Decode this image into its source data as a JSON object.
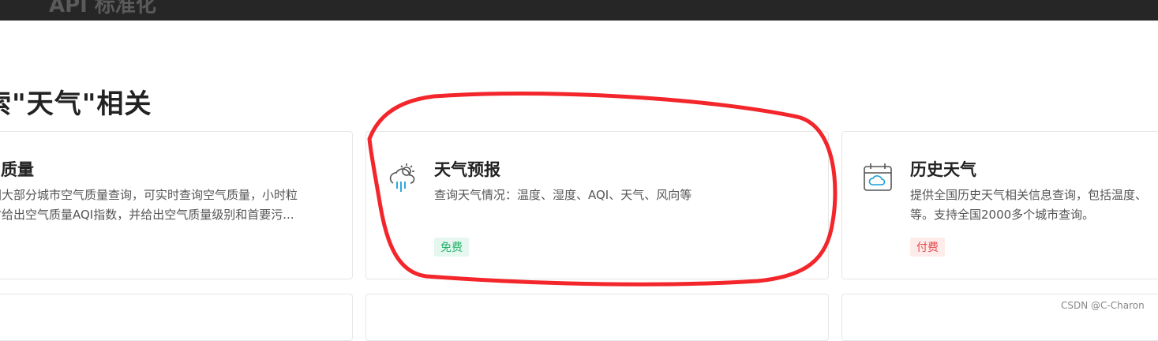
{
  "header": {
    "title": "API 标准化"
  },
  "section": {
    "title": "索\"天气\"相关"
  },
  "cards": [
    {
      "title": "质量",
      "desc_lines": [
        "国大部分城市空气质量查询，可实时查询空气质量，小时粒",
        "时给出空气质量AQI指数，并给出空气质量级别和首要污..."
      ]
    },
    {
      "title": "天气预报",
      "desc": "查询天气情况：温度、湿度、AQI、天气、风向等",
      "badge": "免费",
      "icon": "cloud-sun-rain-icon"
    },
    {
      "title": "历史天气",
      "desc_lines": [
        "提供全国历史天气相关信息查询，包括温度、",
        "等。支持全国2000多个城市查询。"
      ],
      "badge": "付费",
      "icon": "calendar-cloud-icon"
    }
  ],
  "colors": {
    "accent_blue": "#1a9fd8",
    "free_green": "#24b36b",
    "paid_red": "#e5484d",
    "annotation_red": "#f2262b"
  },
  "watermark": "CSDN @C-Charon"
}
